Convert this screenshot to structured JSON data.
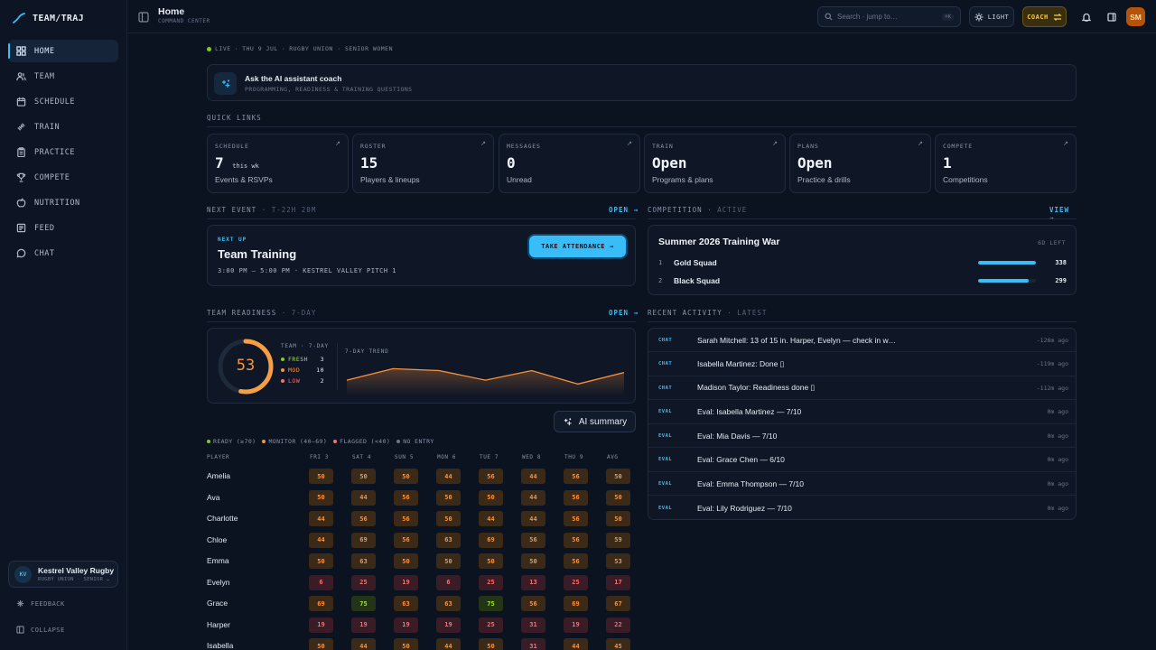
{
  "app": {
    "name": "TEAM/TRAJ"
  },
  "sidebar": {
    "items": [
      {
        "label": "HOME",
        "icon": "grid-icon"
      },
      {
        "label": "TEAM",
        "icon": "users-icon"
      },
      {
        "label": "SCHEDULE",
        "icon": "calendar-icon"
      },
      {
        "label": "TRAIN",
        "icon": "dumbbell-icon"
      },
      {
        "label": "PRACTICE",
        "icon": "clipboard-icon"
      },
      {
        "label": "COMPETE",
        "icon": "trophy-icon"
      },
      {
        "label": "NUTRITION",
        "icon": "apple-icon"
      },
      {
        "label": "FEED",
        "icon": "feed-icon"
      },
      {
        "label": "CHAT",
        "icon": "chat-icon"
      }
    ],
    "club": {
      "initials": "KV",
      "name": "Kestrel Valley Rugby",
      "sub": "RUGBY UNION · SENIOR …"
    },
    "feedback": "FEEDBACK",
    "collapse": "COLLAPSE"
  },
  "header": {
    "title": "Home",
    "subtitle": "COMMAND CENTER",
    "search_placeholder": "Search · jump to…",
    "search_kbd": "⌘K",
    "theme_label": "LIGHT",
    "role_label": "COACH",
    "avatar": "SM"
  },
  "status": {
    "live": "LIVE",
    "date": "THU 9 JUL",
    "sport": "RUGBY UNION · SENIOR WOMEN"
  },
  "assistant": {
    "title": "Ask the AI assistant coach",
    "subtitle": "PROGRAMMING, READINESS & TRAINING QUESTIONS"
  },
  "quick_links": {
    "title": "QUICK LINKS",
    "items": [
      {
        "label": "SCHEDULE",
        "value": "7",
        "unit": "this wk",
        "desc": "Events & RSVPs"
      },
      {
        "label": "ROSTER",
        "value": "15",
        "unit": "",
        "desc": "Players & lineups"
      },
      {
        "label": "MESSAGES",
        "value": "0",
        "unit": "",
        "desc": "Unread"
      },
      {
        "label": "TRAIN",
        "value": "Open",
        "unit": "",
        "desc": "Programs & plans"
      },
      {
        "label": "PLANS",
        "value": "Open",
        "unit": "",
        "desc": "Practice & drills"
      },
      {
        "label": "COMPETE",
        "value": "1",
        "unit": "",
        "desc": "Competitions"
      }
    ]
  },
  "next_event": {
    "title": "NEXT EVENT",
    "countdown": "T-22H 20M",
    "link": "OPEN →",
    "kicker": "NEXT UP",
    "name": "Team Training",
    "meta": "3:00 PM – 5:00 PM · KESTREL VALLEY PITCH 1",
    "button": "TAKE ATTENDANCE"
  },
  "competition": {
    "title": "COMPETITION",
    "state": "ACTIVE",
    "link": "VIEW →",
    "name": "Summer 2026 Training War",
    "days_left": "6D LEFT",
    "teams": [
      {
        "rank": "1",
        "name": "Gold Squad",
        "points": 338
      },
      {
        "rank": "2",
        "name": "Black Squad",
        "points": 299
      }
    ]
  },
  "readiness": {
    "title": "TEAM READINESS",
    "period": "7-DAY",
    "link": "OPEN →",
    "score": "53",
    "score_fraction": 0.53,
    "legend_title": "TEAM · 7-DAY",
    "legend": [
      {
        "label": "FRESH",
        "count": "3",
        "color": "#84cc16"
      },
      {
        "label": "MOD",
        "count": "10",
        "color": "#fb923c"
      },
      {
        "label": "LOW",
        "count": "2",
        "color": "#f87171"
      }
    ],
    "trend_title": "7-DAY TREND",
    "trend": [
      47,
      53,
      52,
      47,
      52,
      45,
      51
    ],
    "ai_summary": "AI summary"
  },
  "heatmap": {
    "legend": [
      {
        "label": "READY (≥70)",
        "color": "#84cc16"
      },
      {
        "label": "MONITOR (40–69)",
        "color": "#fb923c"
      },
      {
        "label": "FLAGGED (<40)",
        "color": "#f87171"
      },
      {
        "label": "NO ENTRY",
        "color": "#6b7689"
      }
    ],
    "player_header": "PLAYER",
    "days": [
      "FRI 3",
      "SAT 4",
      "SUN 5",
      "MON 6",
      "TUE 7",
      "WED 8",
      "THU 9",
      "AVG"
    ],
    "rows": [
      {
        "name": "Amelia",
        "values": [
          50,
          50,
          50,
          44,
          56,
          44,
          56,
          50
        ]
      },
      {
        "name": "Ava",
        "values": [
          50,
          44,
          56,
          50,
          50,
          44,
          56,
          50
        ]
      },
      {
        "name": "Charlotte",
        "values": [
          44,
          56,
          56,
          50,
          44,
          44,
          56,
          50
        ]
      },
      {
        "name": "Chloe",
        "values": [
          44,
          69,
          56,
          63,
          69,
          56,
          56,
          59
        ]
      },
      {
        "name": "Emma",
        "values": [
          50,
          63,
          50,
          50,
          50,
          50,
          56,
          53
        ]
      },
      {
        "name": "Evelyn",
        "values": [
          6,
          25,
          19,
          6,
          25,
          13,
          25,
          17
        ]
      },
      {
        "name": "Grace",
        "values": [
          69,
          75,
          63,
          63,
          75,
          56,
          69,
          67
        ]
      },
      {
        "name": "Harper",
        "values": [
          19,
          19,
          19,
          19,
          25,
          31,
          19,
          22
        ]
      },
      {
        "name": "Isabella",
        "values": [
          50,
          44,
          50,
          44,
          50,
          31,
          44,
          45
        ]
      }
    ]
  },
  "activity": {
    "title": "RECENT ACTIVITY",
    "filter": "LATEST",
    "items": [
      {
        "tag": "CHAT",
        "text": "Sarah Mitchell: 13 of 15 in. Harper, Evelyn — check in w…",
        "ago": "-126m ago"
      },
      {
        "tag": "CHAT",
        "text": "Isabella Martinez: Done ▯",
        "ago": "-119m ago"
      },
      {
        "tag": "CHAT",
        "text": "Madison Taylor: Readiness done ▯",
        "ago": "-112m ago"
      },
      {
        "tag": "EVAL",
        "text": "Eval: Isabella Martinez — 7/10",
        "ago": "0m ago"
      },
      {
        "tag": "EVAL",
        "text": "Eval: Mia Davis — 7/10",
        "ago": "0m ago"
      },
      {
        "tag": "EVAL",
        "text": "Eval: Grace Chen — 6/10",
        "ago": "0m ago"
      },
      {
        "tag": "EVAL",
        "text": "Eval: Emma Thompson — 7/10",
        "ago": "0m ago"
      },
      {
        "tag": "EVAL",
        "text": "Eval: Lily Rodriguez — 7/10",
        "ago": "0m ago"
      }
    ]
  },
  "colors": {
    "accent": "#38bdf8",
    "ready": "#84cc16",
    "monitor": "#fb923c",
    "flagged": "#f87171",
    "coach": "#f5c84a"
  }
}
